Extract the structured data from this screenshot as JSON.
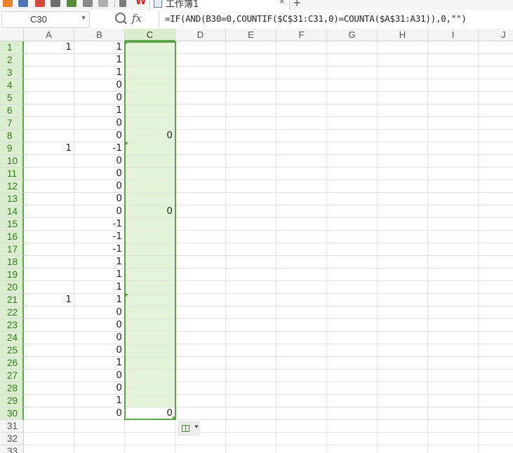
{
  "window": {
    "tab_title": "工作簿1",
    "tab_close": "×",
    "new_tab": "+",
    "brand": "W"
  },
  "formula_bar": {
    "name_box": "C30",
    "fx_label": "fx",
    "formula": "=IF(AND(B30=0,COUNTIF($C$31:C31,0)=COUNTA($A$31:A31)),0,\"\")"
  },
  "columns": [
    "A",
    "B",
    "C",
    "D",
    "E",
    "F",
    "G",
    "H",
    "I",
    "J"
  ],
  "selected_column": "C",
  "active_cell": "C30",
  "rows": [
    {
      "n": "1",
      "a": "1",
      "b": "1",
      "c": ""
    },
    {
      "n": "2",
      "a": "",
      "b": "1",
      "c": ""
    },
    {
      "n": "3",
      "a": "",
      "b": "1",
      "c": ""
    },
    {
      "n": "4",
      "a": "",
      "b": "0",
      "c": ""
    },
    {
      "n": "5",
      "a": "",
      "b": "0",
      "c": ""
    },
    {
      "n": "6",
      "a": "",
      "b": "1",
      "c": ""
    },
    {
      "n": "7",
      "a": "",
      "b": "0",
      "c": ""
    },
    {
      "n": "8",
      "a": "",
      "b": "0",
      "c": "0"
    },
    {
      "n": "9",
      "a": "1",
      "b": "-1",
      "c": ""
    },
    {
      "n": "10",
      "a": "",
      "b": "0",
      "c": ""
    },
    {
      "n": "11",
      "a": "",
      "b": "0",
      "c": ""
    },
    {
      "n": "12",
      "a": "",
      "b": "0",
      "c": ""
    },
    {
      "n": "13",
      "a": "",
      "b": "0",
      "c": ""
    },
    {
      "n": "14",
      "a": "",
      "b": "0",
      "c": "0"
    },
    {
      "n": "15",
      "a": "",
      "b": "-1",
      "c": ""
    },
    {
      "n": "16",
      "a": "",
      "b": "-1",
      "c": ""
    },
    {
      "n": "17",
      "a": "",
      "b": "-1",
      "c": ""
    },
    {
      "n": "18",
      "a": "",
      "b": "1",
      "c": ""
    },
    {
      "n": "19",
      "a": "",
      "b": "1",
      "c": ""
    },
    {
      "n": "20",
      "a": "",
      "b": "1",
      "c": ""
    },
    {
      "n": "21",
      "a": "1",
      "b": "1",
      "c": ""
    },
    {
      "n": "22",
      "a": "",
      "b": "0",
      "c": ""
    },
    {
      "n": "23",
      "a": "",
      "b": "0",
      "c": ""
    },
    {
      "n": "24",
      "a": "",
      "b": "0",
      "c": ""
    },
    {
      "n": "25",
      "a": "",
      "b": "0",
      "c": ""
    },
    {
      "n": "26",
      "a": "",
      "b": "1",
      "c": ""
    },
    {
      "n": "27",
      "a": "",
      "b": "0",
      "c": ""
    },
    {
      "n": "28",
      "a": "",
      "b": "0",
      "c": ""
    },
    {
      "n": "29",
      "a": "",
      "b": "1",
      "c": ""
    },
    {
      "n": "30",
      "a": "",
      "b": "0",
      "c": "0"
    },
    {
      "n": "31",
      "a": "",
      "b": "",
      "c": ""
    },
    {
      "n": "32",
      "a": "",
      "b": "",
      "c": ""
    },
    {
      "n": "33",
      "a": "",
      "b": "",
      "c": ""
    }
  ],
  "selected_rows_from": 1,
  "selected_rows_to": 30,
  "marker_rows": [
    1,
    9,
    21
  ],
  "colors": {
    "selection": "#5ea24a",
    "selection_fill": "#e3f4d8",
    "header_bg": "#f4f4f4"
  }
}
